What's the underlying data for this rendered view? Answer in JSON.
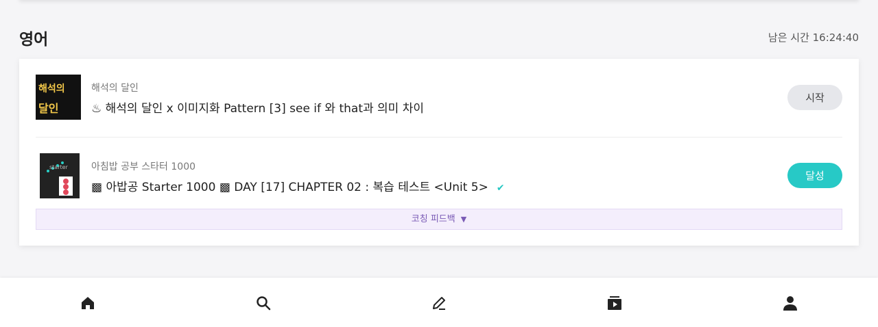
{
  "section": {
    "title": "영어",
    "time_left": "남은 시간 16:24:40"
  },
  "lessons": [
    {
      "course": "해석의 달인",
      "title": "♨ 해석의 달인 x 이미지화 Pattern [3] see if 와 that과 의미 차이",
      "thumb_line1": "해석의",
      "thumb_line2": "달인",
      "button": "시작",
      "completed": false
    },
    {
      "course": "아침밥 공부 스타터 1000",
      "title": "▩ 아밥공 Starter 1000 ▩ DAY [17] CHAPTER 02 : 복습 테스트 <Unit 5>",
      "thumb_label": "starter",
      "button": "달성",
      "completed": true
    }
  ],
  "feedback": {
    "label": "코칭 피드백"
  },
  "nav": [
    "home-icon",
    "search-icon",
    "pencil-icon",
    "media-icon",
    "profile-icon"
  ],
  "colors": {
    "accent": "#27c9c6",
    "feedback_bg": "#f4eefc",
    "feedback_text": "#7a5bb5"
  }
}
